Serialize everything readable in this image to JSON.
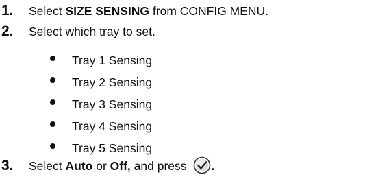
{
  "steps": [
    {
      "number": "1.",
      "prefix": "Select ",
      "bold": "SIZE SENSING",
      "suffix": " from CONFIG MENU."
    },
    {
      "number": "2.",
      "text": "Select which tray to set."
    },
    {
      "number": "3.",
      "prefix": "Select ",
      "bold1": "Auto",
      "middle": " or ",
      "bold2": "Off,",
      "suffix": " and press ",
      "end": "."
    }
  ],
  "trays": [
    "Tray 1 Sensing",
    "Tray 2 Sensing",
    "Tray 3 Sensing",
    "Tray 4 Sensing",
    "Tray 5 Sensing"
  ],
  "icons": {
    "confirm": "checkmark-circle-icon"
  }
}
